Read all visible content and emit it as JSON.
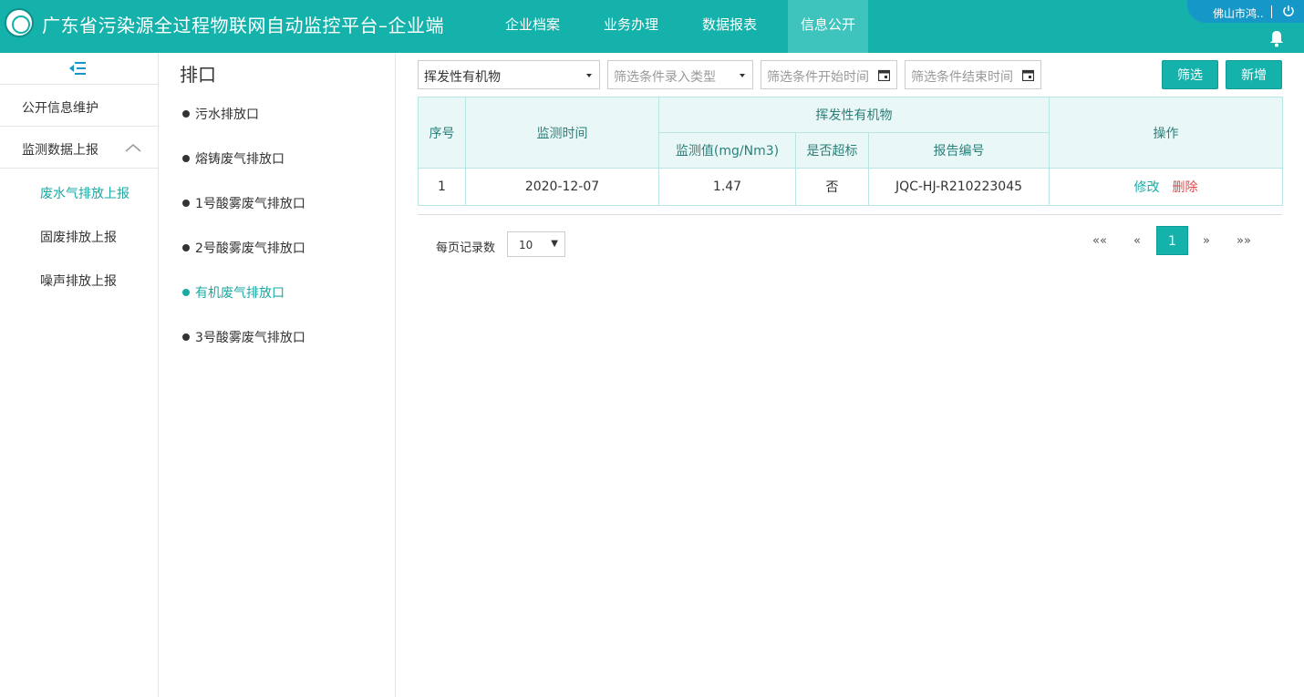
{
  "header": {
    "app_title": "广东省污染源全过程物联网自动监控平台–企业端",
    "nav": [
      "企业档案",
      "业务办理",
      "数据报表",
      "信息公开"
    ],
    "active_nav": "信息公开",
    "user_name": "佛山市鸿..",
    "accent_color": "#15b1ab"
  },
  "sidebar": {
    "items": [
      {
        "label": "公开信息维护"
      },
      {
        "label": "监测数据上报"
      }
    ],
    "sub_items": [
      {
        "label": "废水气排放上报",
        "active": true
      },
      {
        "label": "固废排放上报"
      },
      {
        "label": "噪声排放上报"
      }
    ]
  },
  "outlets": {
    "title": "排口",
    "items": [
      {
        "label": "污水排放口"
      },
      {
        "label": "熔铸废气排放口"
      },
      {
        "label": "1号酸雾废气排放口"
      },
      {
        "label": "2号酸雾废气排放口"
      },
      {
        "label": "有机废气排放口",
        "active": true
      },
      {
        "label": "3号酸雾废气排放口"
      }
    ]
  },
  "filters": {
    "pollutant_value": "挥发性有机物",
    "type_placeholder": "筛选条件录入类型",
    "start_placeholder": "筛选条件开始时间",
    "end_placeholder": "筛选条件结束时间",
    "filter_button": "筛选",
    "add_button": "新增"
  },
  "table": {
    "headers": {
      "seq": "序号",
      "time": "监测时间",
      "group": "挥发性有机物",
      "value": "监测值(mg/Nm3)",
      "exceed": "是否超标",
      "report": "报告编号",
      "ops": "操作"
    },
    "rows": [
      {
        "seq": "1",
        "time": "2020-12-07",
        "value": "1.47",
        "exceed": "否",
        "report": "JQC-HJ-R210223045",
        "edit": "修改",
        "delete": "删除"
      }
    ]
  },
  "pagination": {
    "page_size_label": "每页记录数",
    "page_size": "10",
    "first": "««",
    "prev": "«",
    "current": "1",
    "next": "»",
    "last": "»»"
  }
}
